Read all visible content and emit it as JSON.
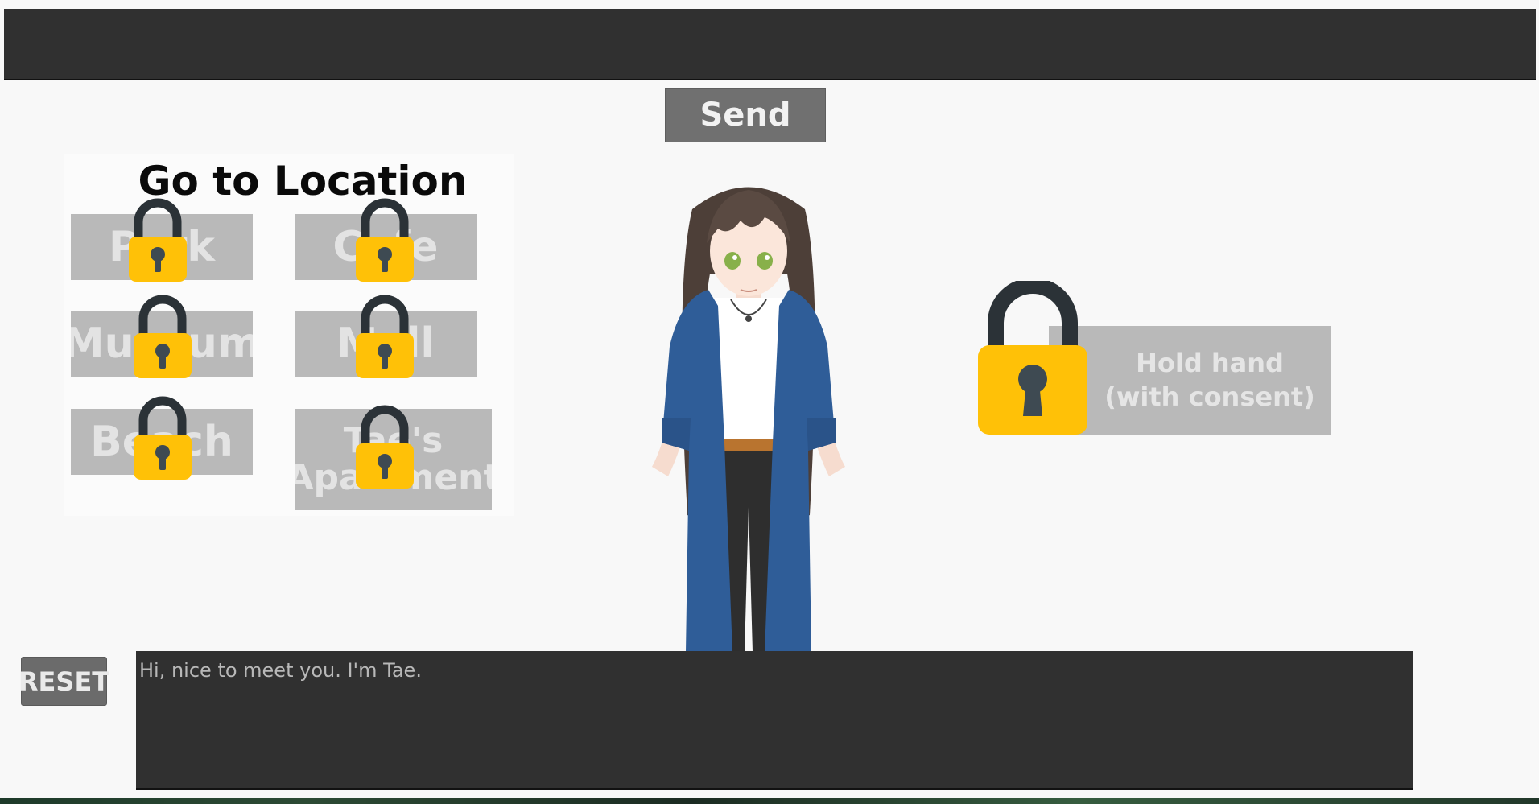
{
  "top_input": {
    "value": ""
  },
  "send_button": {
    "label": "Send"
  },
  "location_panel": {
    "title": "Go to Location",
    "buttons": [
      {
        "label": "Park",
        "locked": true
      },
      {
        "label": "Cafe",
        "locked": true
      },
      {
        "label": "Museum",
        "locked": true
      },
      {
        "label": "Mall",
        "locked": true
      },
      {
        "label": "Beach",
        "locked": true
      },
      {
        "label": "Tae's Apartment",
        "locked": true
      }
    ]
  },
  "action_button": {
    "line1": "Hold hand",
    "line2": "(with consent)",
    "locked": true
  },
  "reset_button": {
    "label": "RESET"
  },
  "dialogue": {
    "text": "Hi, nice to meet you. I'm Tae."
  },
  "colors": {
    "lock_body": "#ffc107",
    "lock_shackle": "#2b3237",
    "panel_dark": "#303030",
    "button_disabled": "#b9b9b9"
  },
  "icons": {
    "lock": "lock-icon"
  }
}
